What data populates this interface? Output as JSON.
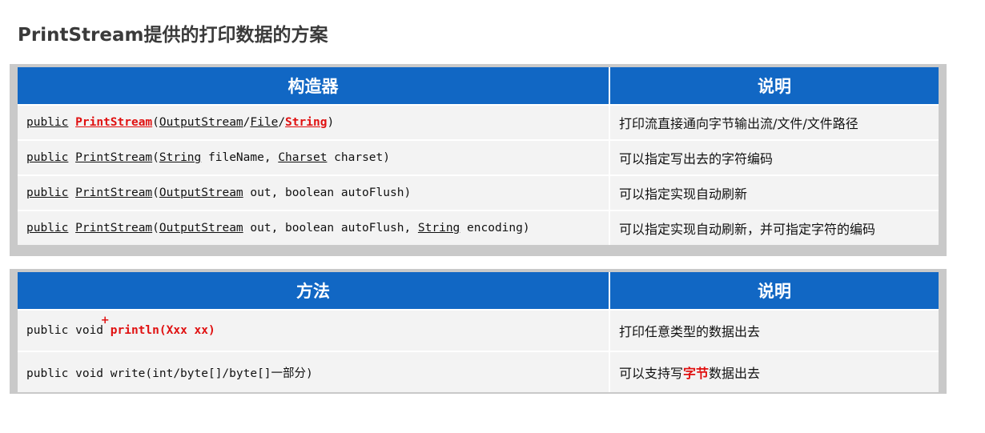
{
  "title": "PrintStream提供的打印数据的方案",
  "table1": {
    "headers": [
      "构造器",
      "说明"
    ],
    "rows": [
      {
        "parts": [
          "public",
          " ",
          "PrintStream",
          "(",
          "OutputStream",
          "/",
          "File",
          "/",
          "String",
          ")"
        ],
        "desc": "打印流直接通向字节输出流/文件/文件路径"
      },
      {
        "parts": [
          "public",
          " ",
          "PrintStream",
          "(",
          "String",
          " fileName, ",
          "Charset",
          " charset)"
        ],
        "desc": "可以指定写出去的字符编码"
      },
      {
        "parts": [
          "public",
          " ",
          "PrintStream",
          "(",
          "OutputStream",
          " out, boolean autoFlush)"
        ],
        "desc": "可以指定实现自动刷新"
      },
      {
        "parts": [
          "public",
          " ",
          "PrintStream",
          "(",
          "OutputStream",
          " out, boolean autoFlush, ",
          "String",
          " encoding)"
        ],
        "desc": "可以指定实现自动刷新，并可指定字符的编码"
      }
    ]
  },
  "table2": {
    "headers": [
      "方法",
      "说明"
    ],
    "rows": [
      {
        "prefix": "public void ",
        "plus": "+",
        "method": "println(Xxx xx)",
        "desc": "打印任意类型的数据出去"
      },
      {
        "prefix": "public void write(int/byte[]/byte[]一部分)",
        "desc_pre": "可以支持写",
        "desc_hl": "字节",
        "desc_post": "数据出去"
      }
    ]
  }
}
